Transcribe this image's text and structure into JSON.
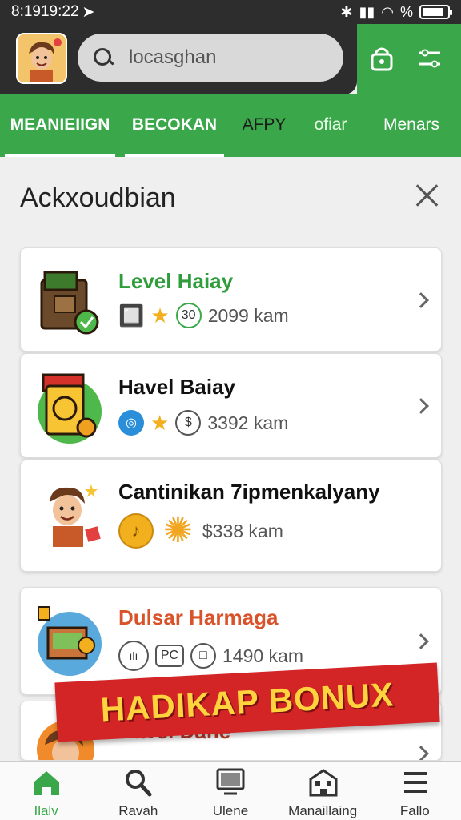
{
  "status_bar": {
    "time": "8:1919:22",
    "battery": "%"
  },
  "search": {
    "placeholder": "locasghan"
  },
  "tabs": [
    {
      "label": "MEANIEIIGN",
      "active": true
    },
    {
      "label": "BECOKAN",
      "active": true
    },
    {
      "label": "AFPY",
      "active": false
    },
    {
      "label": "ofiar",
      "active": false
    },
    {
      "label": "Menars",
      "active": false
    }
  ],
  "section": {
    "title": "Ackxoudbian"
  },
  "cards": [
    {
      "title": "Level Haiay",
      "title_color": "#2f9d3c",
      "distance": "2099 kam"
    },
    {
      "title": "Havel Baiay",
      "title_color": "#111111",
      "distance": "3392 kam"
    },
    {
      "title": "Cantinikan 7ipmenkalyany",
      "title_color": "#111111",
      "distance": "$338 kam"
    },
    {
      "title": "Dulsar Harmaga",
      "title_color": "#d9532a",
      "distance": "1490 kam"
    },
    {
      "title": "Havel Dane",
      "title_color": "#c0392b",
      "distance": ""
    }
  ],
  "card_meta_icons": {
    "c1": [
      "chip-icon",
      "star-icon",
      "30-badge-icon"
    ],
    "c2": [
      "compass-icon",
      "star-icon",
      "dollar-icon"
    ],
    "c3": [
      "coin-icon",
      "sun-icon"
    ],
    "c4": [
      "chart-icon",
      "pc-icon",
      "box-icon"
    ]
  },
  "card_badge_text": {
    "c1": "30",
    "c4_pc": "PC"
  },
  "banner": {
    "text": "HADIKAP BONUX"
  },
  "bottom_nav": [
    {
      "label": "Ilalv",
      "icon": "home-icon",
      "active": true
    },
    {
      "label": "Ravah",
      "icon": "search-icon",
      "active": false
    },
    {
      "label": "Ulene",
      "icon": "monitor-icon",
      "active": false
    },
    {
      "label": "Manaillaing",
      "icon": "building-icon",
      "active": false
    },
    {
      "label": "Fallo",
      "icon": "menu-icon",
      "active": false
    }
  ],
  "colors": {
    "green": "#3aa84a",
    "dark": "#2d2d2d",
    "banner": "#d32426"
  }
}
